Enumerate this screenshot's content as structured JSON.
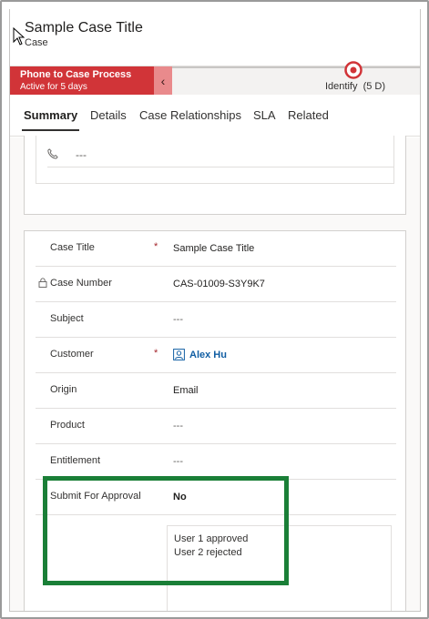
{
  "header": {
    "title": "Sample Case Title",
    "entity": "Case"
  },
  "process": {
    "name": "Phone to Case Process",
    "age": "Active for 5 days",
    "stage_label": "Identify",
    "stage_duration": "(5 D)",
    "stage_color": "#d13438"
  },
  "tabs": [
    {
      "label": "Summary",
      "active": true
    },
    {
      "label": "Details"
    },
    {
      "label": "Case Relationships"
    },
    {
      "label": "SLA"
    },
    {
      "label": "Related"
    }
  ],
  "contact_section": {
    "phone_value": "---"
  },
  "fields": {
    "case_title": {
      "label": "Case Title",
      "required": "*",
      "value": "Sample Case Title"
    },
    "case_number": {
      "label": "Case Number",
      "value": "CAS-01009-S3Y9K7"
    },
    "subject": {
      "label": "Subject",
      "value": "---"
    },
    "customer": {
      "label": "Customer",
      "required": "*",
      "value": "Alex Hu"
    },
    "origin": {
      "label": "Origin",
      "value": "Email"
    },
    "product": {
      "label": "Product",
      "value": "---"
    },
    "entitlement": {
      "label": "Entitlement",
      "value": "---"
    },
    "submit_for_approval": {
      "label": "Submit For Approval",
      "value": "No"
    }
  },
  "approval_history": [
    "User 1 approved",
    "User 2 rejected"
  ],
  "colors": {
    "highlight": "#1a7f37",
    "link": "#115ea3"
  }
}
